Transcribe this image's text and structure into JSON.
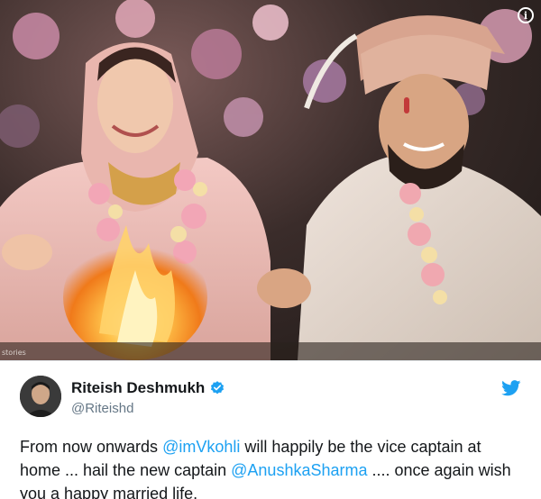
{
  "photo": {
    "credit_text": "stories",
    "info_icon": "info-icon"
  },
  "tweet": {
    "display_name": "Riteish Deshmukh",
    "handle": "@Riteishd",
    "verified_icon": "verified-badge-icon",
    "platform_icon": "twitter-bird-icon",
    "text": {
      "part1": "From now onwards ",
      "mention1": "@imVkohli",
      "part2": " will happily be the vice captain at home ... hail the new captain ",
      "mention2": "@AnushkaSharma",
      "part3": " .... once again wish you a happy married life."
    }
  },
  "colors": {
    "mention": "#1da1f2",
    "text": "#14171a",
    "handle": "#657786",
    "verified": "#1da1f2"
  }
}
